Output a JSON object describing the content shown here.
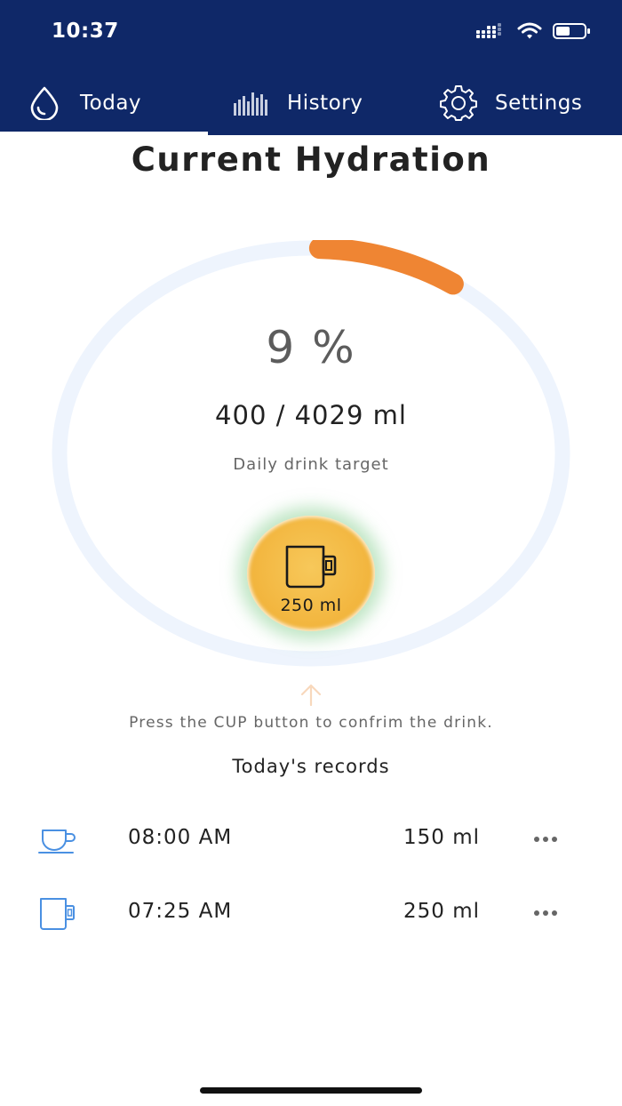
{
  "status_bar": {
    "time": "10:37",
    "icons": [
      "signal-icon",
      "wifi-icon",
      "battery-icon"
    ]
  },
  "tabs": [
    {
      "label": "Today",
      "icon": "water-drop-icon",
      "active": true
    },
    {
      "label": "History",
      "icon": "bar-chart-icon",
      "active": false
    },
    {
      "label": "Settings",
      "icon": "gear-icon",
      "active": false
    }
  ],
  "main": {
    "title": "Current Hydration",
    "percent_text": "9 %",
    "progress_fraction": 0.09,
    "amount_text": "400 / 4029 ml",
    "target_label": "Daily drink target",
    "cup_button": {
      "icon": "mug-icon",
      "label": "250 ml"
    },
    "hint": "Press the CUP button to confrim the drink."
  },
  "records": {
    "title": "Today's records",
    "items": [
      {
        "icon": "teacup-icon",
        "time": "08:00 AM",
        "amount": "150 ml"
      },
      {
        "icon": "mug-icon",
        "time": "07:25 AM",
        "amount": "250 ml"
      }
    ]
  },
  "colors": {
    "header_bg": "#0f2868",
    "progress": "#ef8533",
    "ring_track": "#eef4fd",
    "cup_button": "#f2b43c",
    "cup_glow": "#8cd296",
    "record_icon": "#4a90e2"
  }
}
